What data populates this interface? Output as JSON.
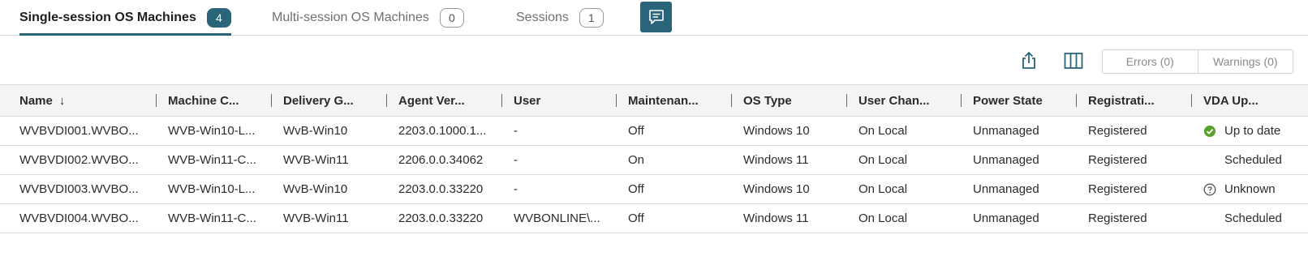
{
  "tabs": [
    {
      "label": "Single-session OS Machines",
      "count": "4",
      "active": true
    },
    {
      "label": "Multi-session OS Machines",
      "count": "0",
      "active": false
    },
    {
      "label": "Sessions",
      "count": "1",
      "active": false
    }
  ],
  "toolbar": {
    "icons": [
      "export-icon",
      "columns-icon",
      "chat-icon"
    ],
    "filters": {
      "errors": "Errors (0)",
      "warnings": "Warnings (0)"
    }
  },
  "table": {
    "columns": [
      "Name",
      "Machine C...",
      "Delivery G...",
      "Agent Ver...",
      "User",
      "Maintenan...",
      "OS Type",
      "User Chan...",
      "Power State",
      "Registrati...",
      "VDA Up..."
    ],
    "sort_icon": "arrow-down",
    "rows": [
      {
        "name": "WVBVDI001.WVBO...",
        "machine_catalog": "WVB-Win10-L...",
        "delivery_group": "WvB-Win10",
        "agent_version": "2203.0.1000.1...",
        "user": "-",
        "maintenance": "Off",
        "os_type": "Windows 10",
        "user_changes": "On Local",
        "power_state": "Unmanaged",
        "registration": "Registered",
        "vda_status": "Up to date",
        "vda_icon": "check-icon"
      },
      {
        "name": "WVBVDI002.WVBO...",
        "machine_catalog": "WVB-Win11-C...",
        "delivery_group": "WVB-Win11",
        "agent_version": "2206.0.0.34062",
        "user": "-",
        "maintenance": "On",
        "os_type": "Windows 11",
        "user_changes": "On Local",
        "power_state": "Unmanaged",
        "registration": "Registered",
        "vda_status": "Scheduled",
        "vda_icon": ""
      },
      {
        "name": "WVBVDI003.WVBO...",
        "machine_catalog": "WVB-Win10-L...",
        "delivery_group": "WvB-Win10",
        "agent_version": "2203.0.0.33220",
        "user": "-",
        "maintenance": "Off",
        "os_type": "Windows 10",
        "user_changes": "On Local",
        "power_state": "Unmanaged",
        "registration": "Registered",
        "vda_status": "Unknown",
        "vda_icon": "question-icon"
      },
      {
        "name": "WVBVDI004.WVBO...",
        "machine_catalog": "WVB-Win11-C...",
        "delivery_group": "WVB-Win11",
        "agent_version": "2203.0.0.33220",
        "user": "WVBONLINE\\...",
        "maintenance": "Off",
        "os_type": "Windows 11",
        "user_changes": "On Local",
        "power_state": "Unmanaged",
        "registration": "Registered",
        "vda_status": "Scheduled",
        "vda_icon": ""
      }
    ]
  },
  "colors": {
    "accent": "#2a6478",
    "success": "#5aa02c"
  }
}
